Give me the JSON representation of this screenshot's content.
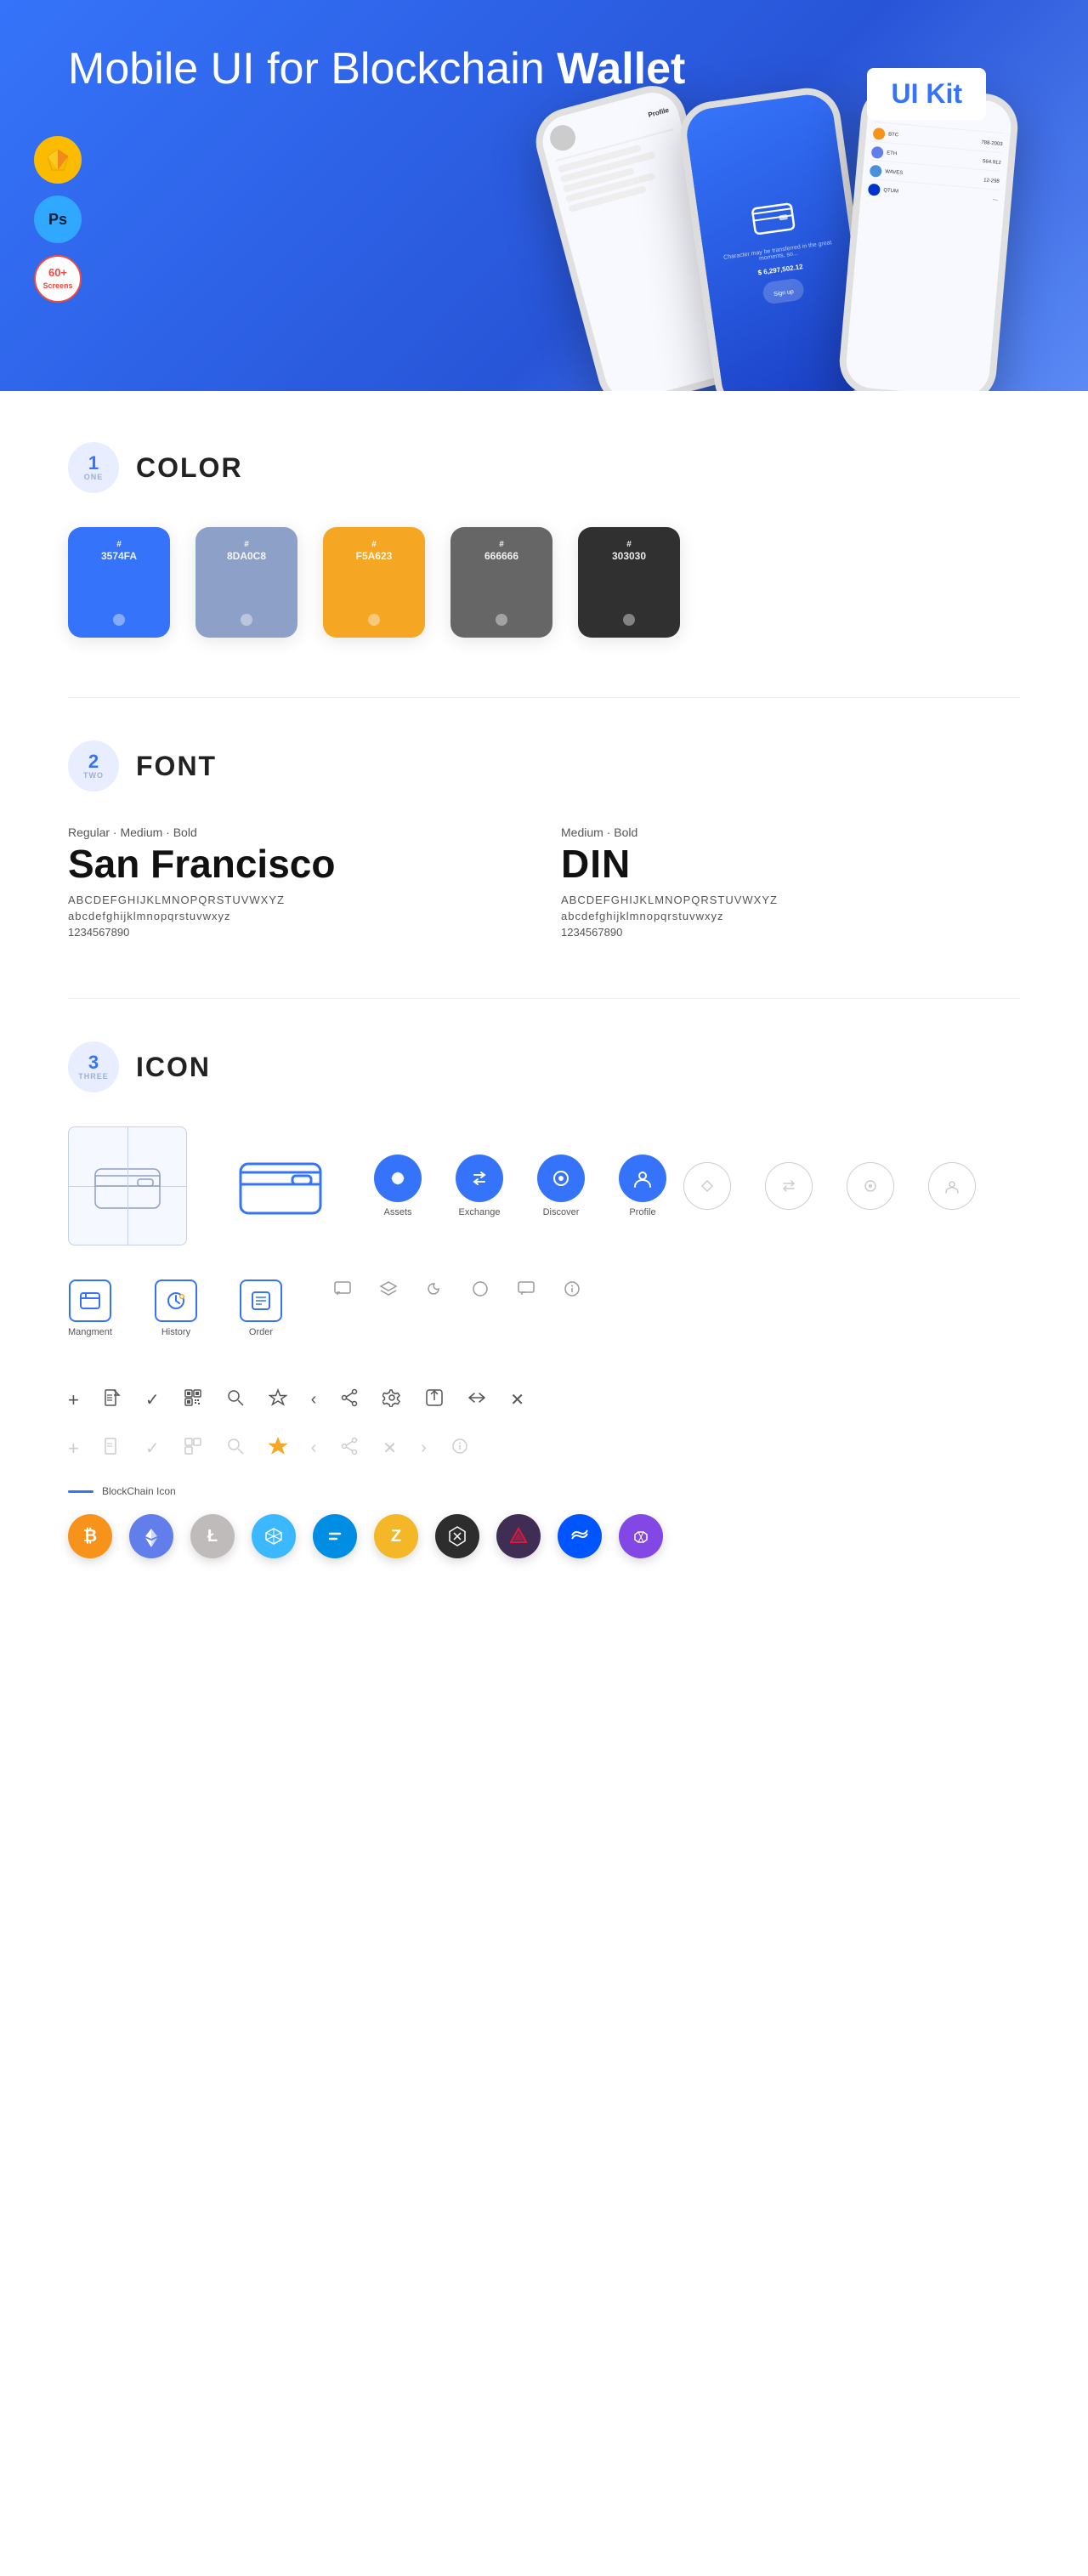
{
  "hero": {
    "title_regular": "Mobile UI for Blockchain ",
    "title_bold": "Wallet",
    "badge": "UI Kit",
    "tools": [
      {
        "name": "Sketch",
        "label": "S"
      },
      {
        "name": "Photoshop",
        "label": "Ps"
      }
    ],
    "screens_badge": "60+\nScreens"
  },
  "sections": {
    "color": {
      "number": "1",
      "word": "ONE",
      "title": "COLOR",
      "swatches": [
        {
          "hex": "#3574FA",
          "label": "#\n3574FA",
          "dot": true
        },
        {
          "hex": "#8DA0C8",
          "label": "#\n8DA0C8",
          "dot": true
        },
        {
          "hex": "#F5A623",
          "label": "#\nF5A623",
          "dot": true
        },
        {
          "hex": "#666666",
          "label": "#\n666666",
          "dot": true
        },
        {
          "hex": "#303030",
          "label": "#\n303030",
          "dot": true
        }
      ]
    },
    "font": {
      "number": "2",
      "word": "TWO",
      "title": "FONT",
      "fonts": [
        {
          "style_label": "Regular · Medium · Bold",
          "name": "San Francisco",
          "uppercase": "ABCDEFGHIJKLMNOPQRSTUVWXYZ",
          "lowercase": "abcdefghijklmnopqrstuvwxyz",
          "numbers": "1234567890"
        },
        {
          "style_label": "Medium · Bold",
          "name": "DIN",
          "uppercase": "ABCDEFGHIJKLMNOPQRSTUVWXYZ",
          "lowercase": "abcdefghijklmnopqrstuvwxyz",
          "numbers": "1234567890"
        }
      ]
    },
    "icon": {
      "number": "3",
      "word": "THREE",
      "title": "ICON",
      "nav_icons": [
        {
          "label": "Assets",
          "color": "#3574FA"
        },
        {
          "label": "Exchange",
          "color": "#3574FA"
        },
        {
          "label": "Discover",
          "color": "#3574FA"
        },
        {
          "label": "Profile",
          "color": "#3574FA"
        }
      ],
      "tab_icons": [
        {
          "label": "Mangment"
        },
        {
          "label": "History"
        },
        {
          "label": "Order"
        }
      ],
      "blockchain_label": "BlockChain Icon",
      "crypto_coins": [
        {
          "name": "Bitcoin",
          "symbol": "₿",
          "color": "#F7931A"
        },
        {
          "name": "Ethereum",
          "symbol": "Ξ",
          "color": "#627EEA"
        },
        {
          "name": "Litecoin",
          "symbol": "Ł",
          "color": "#BFBBBB"
        },
        {
          "name": "Nem",
          "symbol": "N",
          "color": "#67B2E8"
        },
        {
          "name": "Dash",
          "symbol": "D",
          "color": "#008DE4"
        },
        {
          "name": "Zcash",
          "symbol": "Z",
          "color": "#F4B728"
        },
        {
          "name": "IOTA",
          "symbol": "◇",
          "color": "#242424"
        },
        {
          "name": "Augur",
          "symbol": "▲",
          "color": "#402D54"
        },
        {
          "name": "Waves",
          "symbol": "W",
          "color": "#0055FF"
        },
        {
          "name": "Polygon",
          "symbol": "⬡",
          "color": "#8247E5"
        }
      ]
    }
  }
}
